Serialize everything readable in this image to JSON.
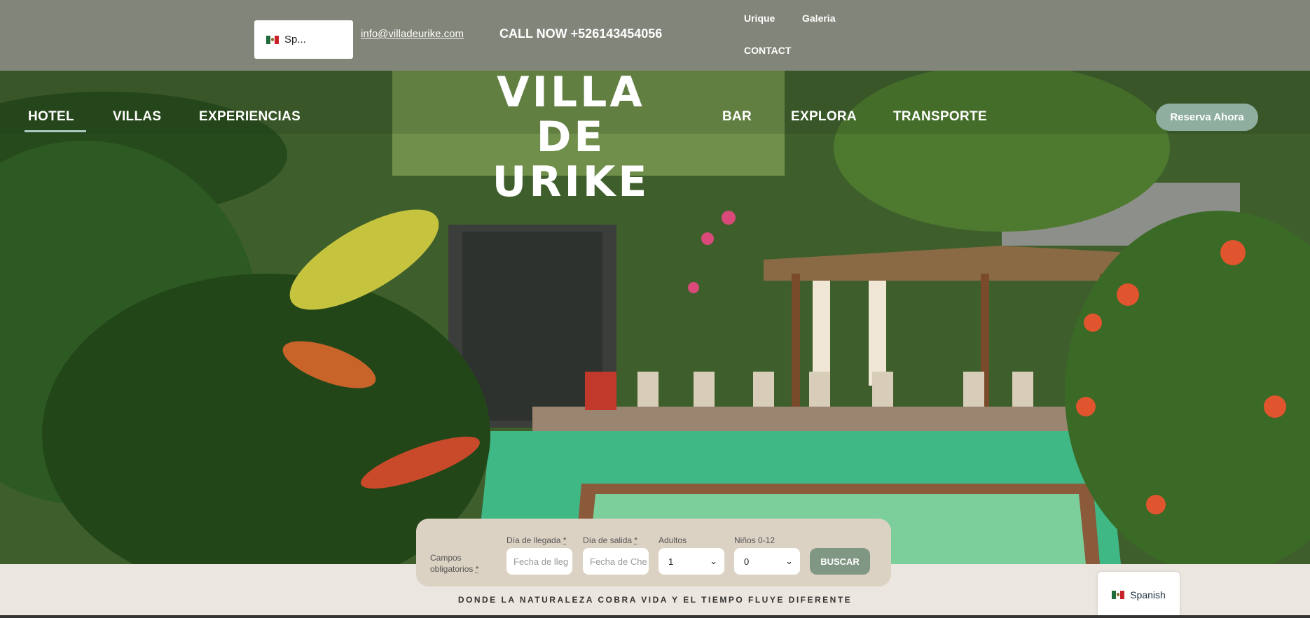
{
  "topbar": {
    "language": "Sp...",
    "email": "info@villadeurike.com",
    "phone": "CALL NOW +526143454056",
    "links": [
      "Urique",
      "Galeria",
      "CONTACT"
    ]
  },
  "nav": {
    "left": [
      "HOTEL",
      "VILLAS",
      "EXPERIENCIAS"
    ],
    "right": [
      "BAR",
      "EXPLORA",
      "TRANSPORTE"
    ],
    "active": "HOTEL"
  },
  "logo": {
    "line1": "VILLA DE",
    "line2": "URIKE"
  },
  "reserve_button": "Reserva Ahora",
  "booking": {
    "required_note": "Campos obligatorios",
    "required_mark": "*",
    "arrival_label": "Día de llegada",
    "arrival_placeholder": "Fecha de lleg",
    "departure_label": "Día de salida",
    "departure_placeholder": "Fecha de Che",
    "adults_label": "Adultos",
    "adults_value": "1",
    "children_label": "Niños 0-12",
    "children_value": "0",
    "search_button": "BUSCAR"
  },
  "tagline": "DONDE LA NATURALEZA COBRA VIDA Y EL TIEMPO FLUYE DIFERENTE",
  "language_widget": "Spanish",
  "colors": {
    "topbar": "#82857a",
    "accent": "#8fae9f",
    "search": "#7f9783",
    "pool": "#3fb886"
  }
}
